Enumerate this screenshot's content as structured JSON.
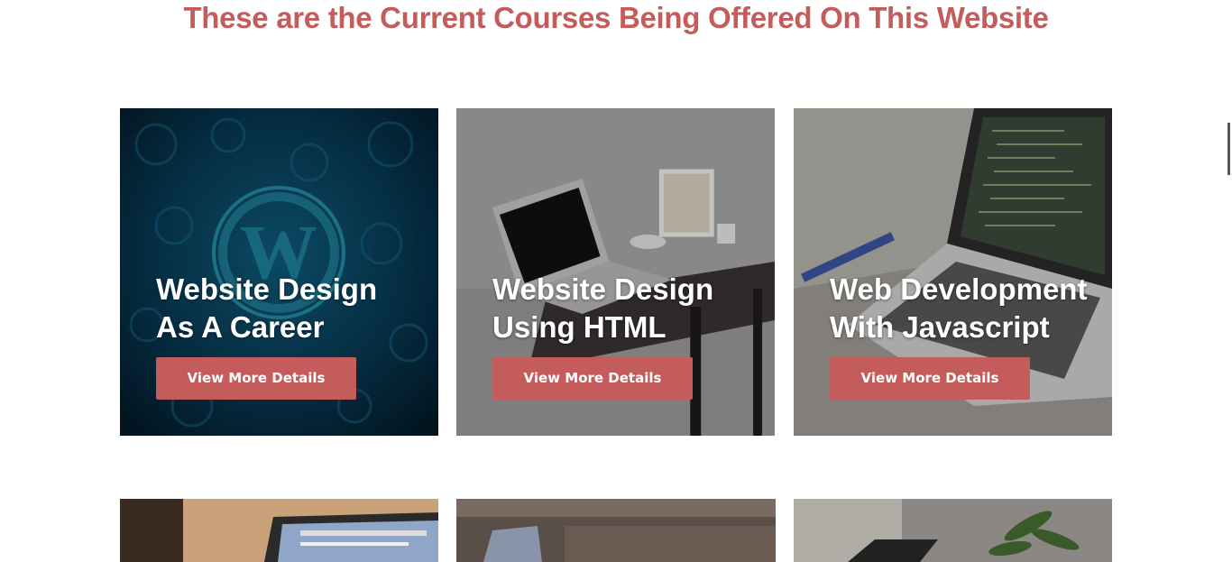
{
  "section": {
    "title": "These are the Current Courses Being Offered On This Website"
  },
  "courses": [
    {
      "title": "Website Design As A Career",
      "button_label": "View More Details",
      "image": "wordpress-logo-background"
    },
    {
      "title": "Website Design Using HTML",
      "button_label": "View More Details",
      "image": "laptop-on-desk-photo"
    },
    {
      "title": "Web Development With Javascript",
      "button_label": "View More Details",
      "image": "laptop-with-code-photo"
    }
  ],
  "lower_courses": [
    {
      "image": "laptop-screen-photo"
    },
    {
      "image": "desk-laptop-photo"
    },
    {
      "image": "plant-laptop-photo"
    }
  ],
  "colors": {
    "accent": "#c45c5c",
    "card_text": "#ffffff"
  }
}
